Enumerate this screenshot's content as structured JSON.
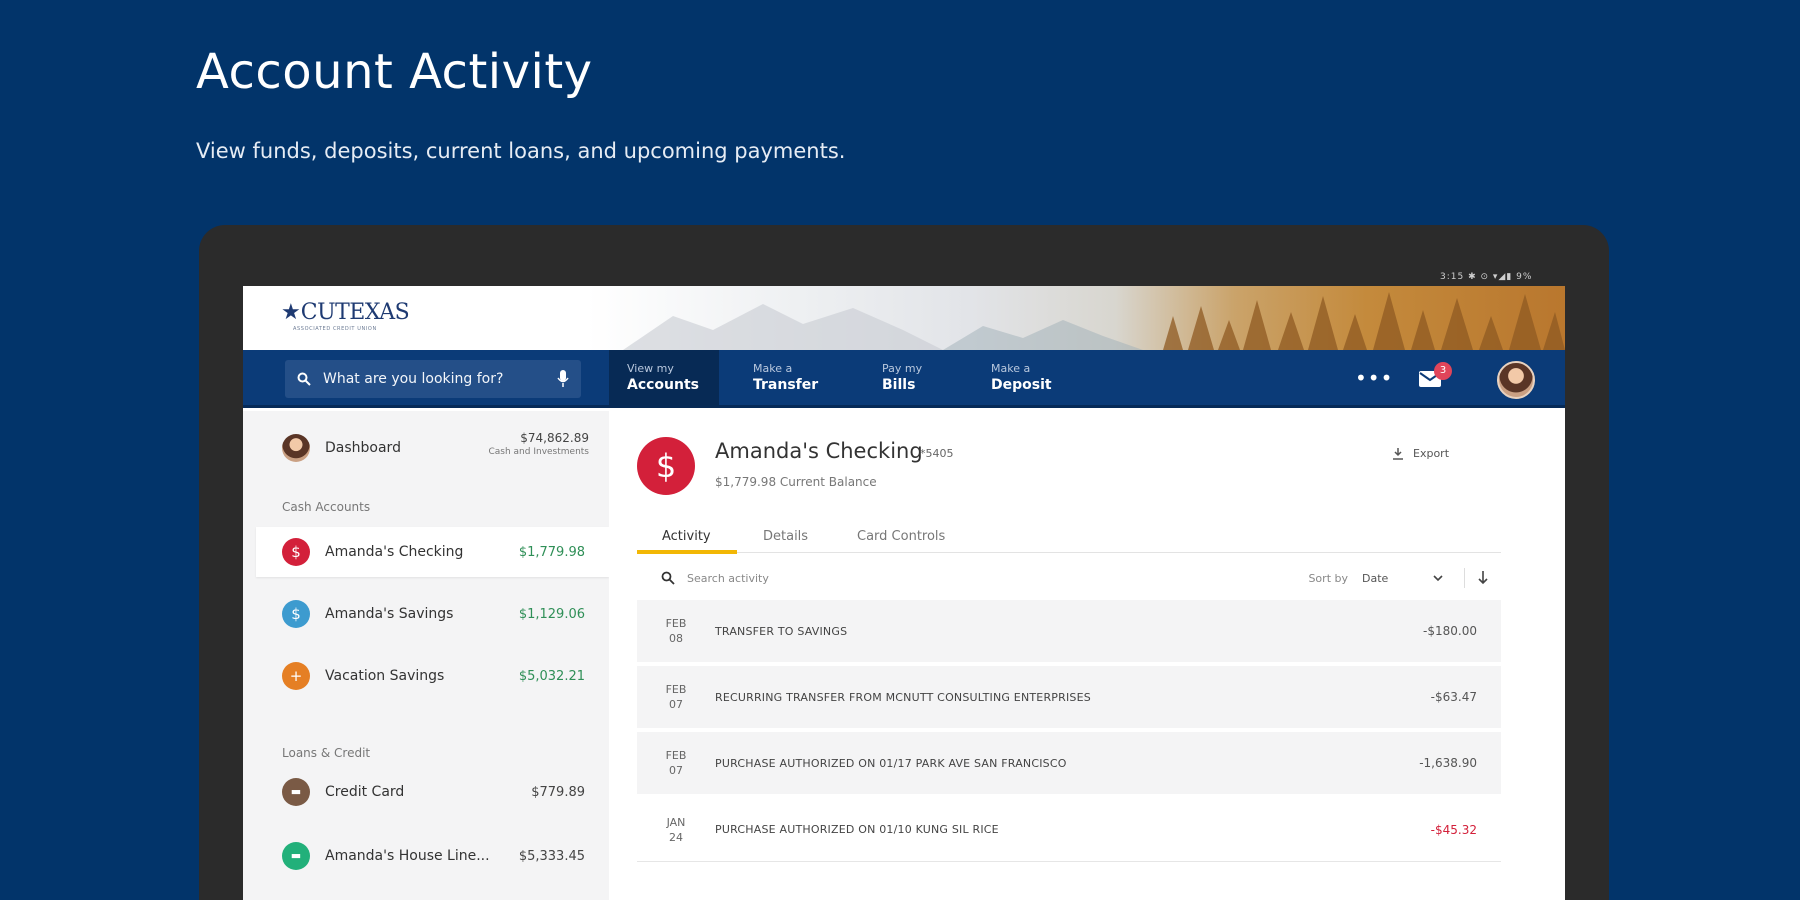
{
  "promo": {
    "title": "Account Activity",
    "subtitle": "View funds, deposits, current loans, and upcoming payments."
  },
  "status_bar": "3:15 ✱ ⊙ ▾◢▮ 9%",
  "brand": {
    "logo_text": "CUTEXAS",
    "logo_tagline": "ASSOCIATED CREDIT UNION"
  },
  "nav": {
    "search_placeholder": "What are you looking for?",
    "items": [
      {
        "small": "View my",
        "big": "Accounts",
        "active": true
      },
      {
        "small": "Make a",
        "big": "Transfer",
        "active": false
      },
      {
        "small": "Pay my",
        "big": "Bills",
        "active": false
      },
      {
        "small": "Make a",
        "big": "Deposit",
        "active": false
      }
    ],
    "more_label": "•••",
    "mail_badge": "3"
  },
  "sidebar": {
    "dashboard": {
      "label": "Dashboard",
      "amount": "$74,862.89",
      "sub": "Cash and Investments"
    },
    "cash_heading": "Cash Accounts",
    "cash_accounts": [
      {
        "label": "Amanda's Checking",
        "amount": "$1,779.98",
        "icon": "$",
        "color": "#d3203a"
      },
      {
        "label": "Amanda's Savings",
        "amount": "$1,129.06",
        "icon": "$",
        "color": "#3d9bcf"
      },
      {
        "label": "Vacation Savings",
        "amount": "$5,032.21",
        "icon": "+",
        "color": "#e57f24"
      }
    ],
    "loans_heading": "Loans & Credit",
    "loans": [
      {
        "label": "Credit Card",
        "amount": "$779.89",
        "icon": "▬",
        "color": "#7a5a45"
      },
      {
        "label": "Amanda's House Line...",
        "amount": "$5,333.45",
        "icon": "▬",
        "color": "#22b07a"
      }
    ]
  },
  "account": {
    "icon": "$",
    "name": "Amanda's Checking",
    "number": "*5405",
    "balance": "$1,779.98 Current Balance",
    "export_label": "Export"
  },
  "tabs": [
    "Activity",
    "Details",
    "Card Controls"
  ],
  "activity": {
    "search_placeholder": "Search activity",
    "sort_label": "Sort by",
    "sort_value": "Date",
    "transactions": [
      {
        "month": "FEB",
        "day": "08",
        "desc": "TRANSFER TO SAVINGS",
        "amount": "-$180.00",
        "negative": false
      },
      {
        "month": "FEB",
        "day": "07",
        "desc": "RECURRING TRANSFER FROM MCNUTT CONSULTING ENTERPRISES",
        "amount": "-$63.47",
        "negative": false
      },
      {
        "month": "FEB",
        "day": "07",
        "desc": "PURCHASE AUTHORIZED ON 01/17 PARK AVE SAN FRANCISCO",
        "amount": "-1,638.90",
        "negative": false
      },
      {
        "month": "JAN",
        "day": "24",
        "desc": "PURCHASE AUTHORIZED ON 01/10 KUNG SIL RICE",
        "amount": "-$45.32",
        "negative": true
      }
    ]
  }
}
